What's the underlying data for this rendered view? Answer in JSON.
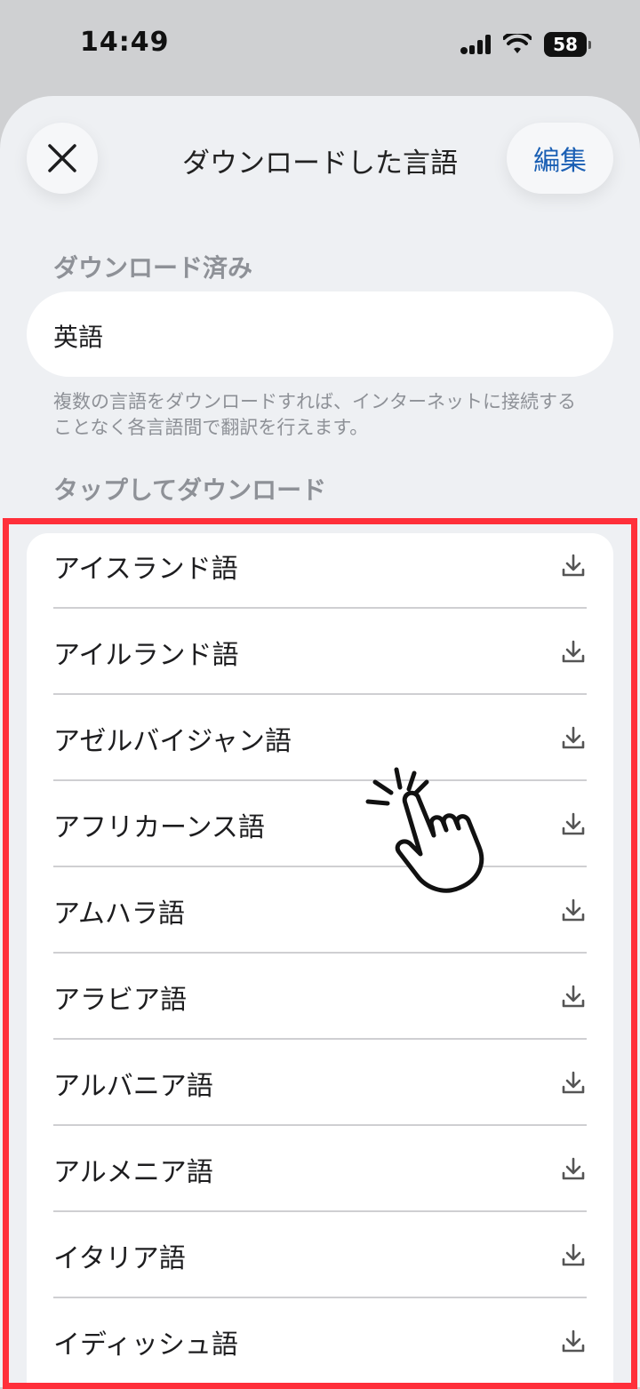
{
  "status_bar": {
    "time": "14:49",
    "battery": "58",
    "icons": [
      "cellular-icon",
      "wifi-icon",
      "battery-icon"
    ]
  },
  "header": {
    "title": "ダウンロードした言語",
    "edit_label": "編集",
    "close_icon": "close-icon"
  },
  "downloaded": {
    "section_label": "ダウンロード済み",
    "items": [
      "英語"
    ],
    "note": "複数の言語をダウンロードすれば、インターネットに接続することなく各言語間で翻訳を行えます。"
  },
  "available": {
    "section_label": "タップしてダウンロード",
    "items": [
      "アイスランド語",
      "アイルランド語",
      "アゼルバイジャン語",
      "アフリカーンス語",
      "アムハラ語",
      "アラビア語",
      "アルバニア語",
      "アルメニア語",
      "イタリア語",
      "イディッシュ語"
    ],
    "row_icon": "download-icon"
  },
  "colors": {
    "accent": "#1a5fb4",
    "highlight": "#ff2f3a",
    "sheet_bg": "#eef0f3"
  }
}
